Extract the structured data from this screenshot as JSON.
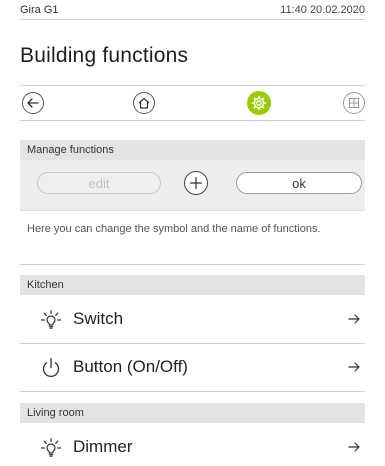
{
  "status_bar": {
    "brand": "Gira G1",
    "time": "11:40 20.02.2020"
  },
  "page": {
    "title": "Building functions"
  },
  "nav": {
    "back_icon": "arrow-left-icon",
    "home_icon": "house-icon",
    "settings_icon": "gear-icon",
    "grid_icon": "grid-icon",
    "active_color": "#99cc00"
  },
  "manage": {
    "header": "Manage functions",
    "edit_label": "edit",
    "add_icon": "plus-icon",
    "ok_label": "ok",
    "hint": "Here you can change the symbol and the name of functions."
  },
  "groups": [
    {
      "header": "Kitchen",
      "items": [
        {
          "label": "Switch",
          "icon": "lightbulb-icon"
        },
        {
          "label": "Button (On/Off)",
          "icon": "power-icon"
        }
      ]
    },
    {
      "header": "Living room",
      "items": [
        {
          "label": "Dimmer",
          "icon": "lightbulb-icon"
        }
      ]
    }
  ]
}
